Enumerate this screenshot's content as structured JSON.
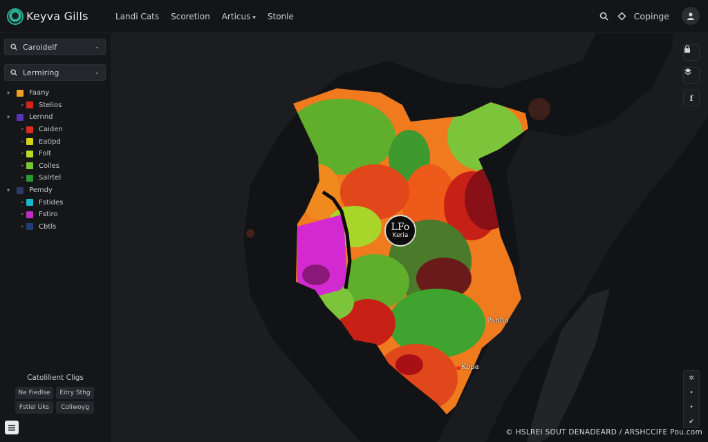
{
  "header": {
    "app_title": "Keyva Gills",
    "nav": [
      {
        "label": "Landi Cats",
        "dropdown": false
      },
      {
        "label": "Scoretion",
        "dropdown": false
      },
      {
        "label": "Articus",
        "dropdown": true
      },
      {
        "label": "Stonle",
        "dropdown": false
      }
    ],
    "share_label": "Copinge",
    "icons": {
      "search": "search-icon",
      "share": "diamond-icon",
      "user": "user-icon"
    }
  },
  "sidebar": {
    "search": {
      "value": "Caroidelf"
    },
    "layer_select": {
      "value": "Lermiring"
    },
    "layers": [
      {
        "label": "Faany",
        "level": "group",
        "color": "#f0a020"
      },
      {
        "label": "Stelios",
        "level": "child",
        "color": "#d8231d"
      },
      {
        "label": "Lernnd",
        "level": "group",
        "color": "#5a33b8"
      },
      {
        "label": "Caiden",
        "level": "child",
        "color": "#dc2a1e"
      },
      {
        "label": "Eatipd",
        "level": "child",
        "color": "#d9d11b"
      },
      {
        "label": "Folt",
        "level": "child",
        "color": "#b9dc25"
      },
      {
        "label": "Coiles",
        "level": "child",
        "color": "#78c832"
      },
      {
        "label": "Salrtel",
        "level": "child",
        "color": "#2a9a2e"
      },
      {
        "label": "Pemdy",
        "level": "group",
        "color": "#2b3a66"
      },
      {
        "label": "Fstides",
        "level": "child",
        "color": "#1ab8d0"
      },
      {
        "label": "Fstiro",
        "level": "child",
        "color": "#c42bc8"
      },
      {
        "label": "Cbtls",
        "level": "child",
        "color": "#1f3f78"
      }
    ],
    "legend_title": "Catolilient Cligs",
    "legend_chips": [
      "Ne Fiedlse",
      "Eitry Sthg",
      "Fstiel Uks",
      "Coliwoyg"
    ],
    "menu_icon": "menu-icon"
  },
  "map": {
    "callout": {
      "line1": "LFo",
      "line2": "Keria"
    },
    "labels": {
      "east": "Panfio",
      "south": "Kopa"
    },
    "right_controls": [
      "lock-icon",
      "layers-icon",
      "facebook-icon"
    ],
    "zoom_controls": [
      "compass-icon",
      "zoom-in-icon",
      "zoom-out-icon",
      "locate-icon"
    ],
    "attribution": "© HSLREI SOUT DENADEARD / ARSHCCIFE Pou.com"
  }
}
